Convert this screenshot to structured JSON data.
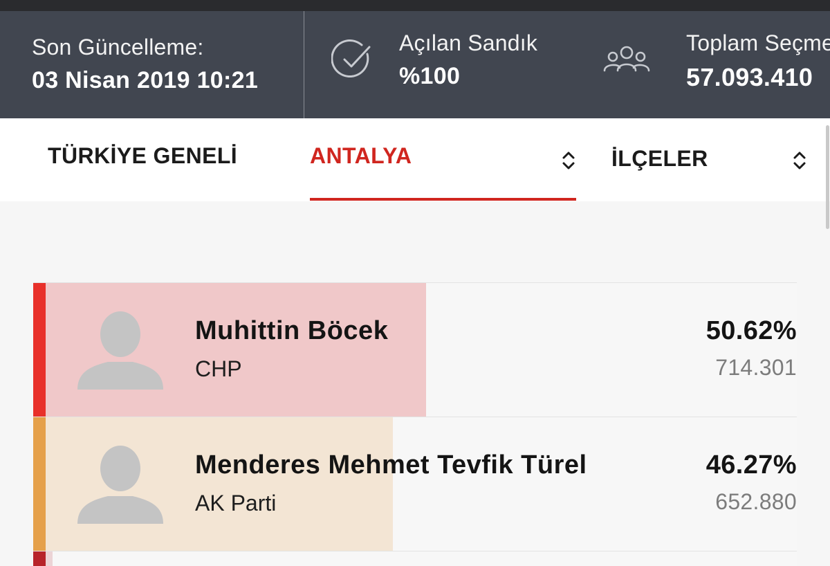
{
  "header": {
    "last_update_label": "Son Güncelleme:",
    "last_update_value": "03 Nisan 2019 10:21",
    "ballot_label": "Açılan Sandık",
    "ballot_value": "%100",
    "voters_label": "Toplam Seçmen",
    "voters_value": "57.093.410",
    "ballot_icon": "check-circle-icon",
    "voters_icon": "people-icon"
  },
  "tabs": {
    "general": "TÜRKİYE GENELİ",
    "city": "ANTALYA",
    "districts": "İLÇELER",
    "active_color": "#d0261f"
  },
  "candidates": [
    {
      "name": "Muhittin Böcek",
      "party": "CHP",
      "percent_text": "50.62%",
      "percent": 50.62,
      "votes": "714.301",
      "stripe_color": "#e8302a",
      "fill_color": "#f0c8c9"
    },
    {
      "name": "Menderes Mehmet Tevfik Türel",
      "party": "AK Parti",
      "percent_text": "46.27%",
      "percent": 46.27,
      "votes": "652.880",
      "stripe_color": "#e5a04a",
      "fill_color": "#f3e5d4"
    }
  ],
  "partial_row": {
    "stripe_color": "#b7242a",
    "fill_color": "#ecd4d6"
  }
}
